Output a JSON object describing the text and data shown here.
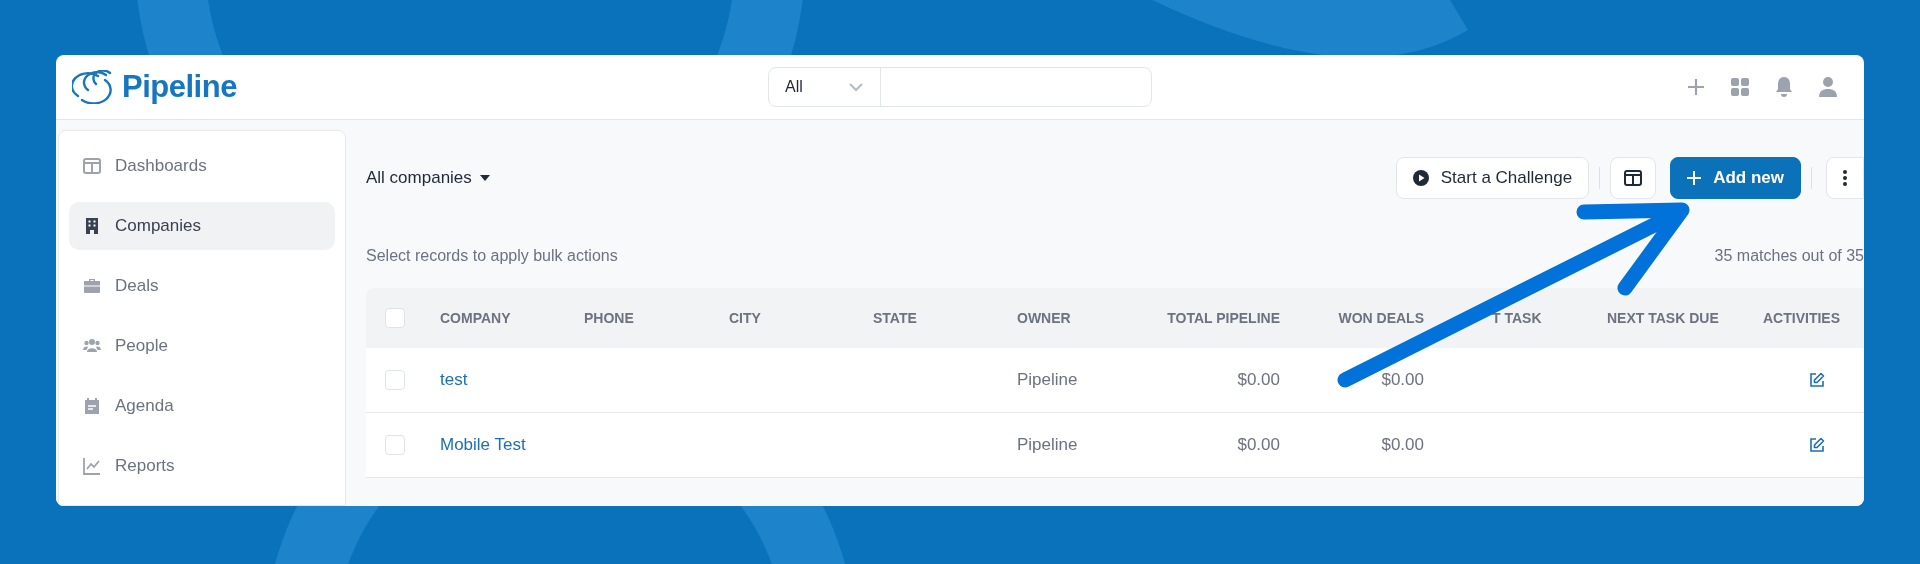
{
  "header": {
    "logo_text": "Pipeline",
    "search_scope": "All"
  },
  "sidebar": {
    "items": [
      {
        "label": "Dashboards",
        "selected": false
      },
      {
        "label": "Companies",
        "selected": true
      },
      {
        "label": "Deals",
        "selected": false
      },
      {
        "label": "People",
        "selected": false
      },
      {
        "label": "Agenda",
        "selected": false
      },
      {
        "label": "Reports",
        "selected": false
      }
    ]
  },
  "view": {
    "title": "All companies",
    "challenge_button": "Start a Challenge",
    "add_button": "Add new",
    "bulk_hint": "Select records to apply bulk actions",
    "match_count": "35 matches out of 35"
  },
  "table": {
    "header_checked": false,
    "columns": [
      {
        "label": "COMPANY",
        "kind": "link"
      },
      {
        "label": "PHONE",
        "kind": "text"
      },
      {
        "label": "CITY",
        "kind": "text"
      },
      {
        "label": "STATE",
        "kind": "text"
      },
      {
        "label": "OWNER",
        "kind": "text"
      },
      {
        "label": "TOTAL PIPELINE",
        "kind": "money"
      },
      {
        "label": "WON DEALS",
        "kind": "money"
      },
      {
        "label": "T TASK",
        "kind": "text"
      },
      {
        "label": "NEXT TASK DUE",
        "kind": "text"
      },
      {
        "label": "ACTIVITIES",
        "kind": "action"
      }
    ],
    "rows": [
      {
        "checked": false,
        "cells": [
          "test",
          null,
          null,
          null,
          "Pipeline",
          "$0.00",
          "$0.00",
          null,
          null,
          null
        ]
      },
      {
        "checked": false,
        "cells": [
          "Mobile Test",
          null,
          null,
          null,
          "Pipeline",
          "$0.00",
          "$0.00",
          null,
          null,
          null
        ]
      }
    ]
  }
}
